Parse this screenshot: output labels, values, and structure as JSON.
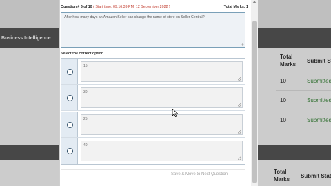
{
  "background": {
    "band_title": "Business Intelligence",
    "headers": [
      "Total Marks",
      "Submit Status"
    ],
    "headers_lower": [
      "Total Marks",
      "Submit Status"
    ],
    "rows": [
      {
        "marks": "10",
        "status": "Submitted"
      },
      {
        "marks": "10",
        "status": "Submitted"
      },
      {
        "marks": "10",
        "status": "Submitted"
      }
    ]
  },
  "modal": {
    "question_number": "Question # 6 of 10",
    "start_time": "( Start time: 09:16:39 PM, 12 September 2022 )",
    "total_marks_label": "Total Marks: 1",
    "question_text": "After how many days an Amazon Seller can change the name of store on Seller Central?",
    "select_label": "Select the correct option",
    "options": [
      "15",
      "30",
      "25",
      "40"
    ],
    "submit_label": "Save & Move to Next Question"
  }
}
